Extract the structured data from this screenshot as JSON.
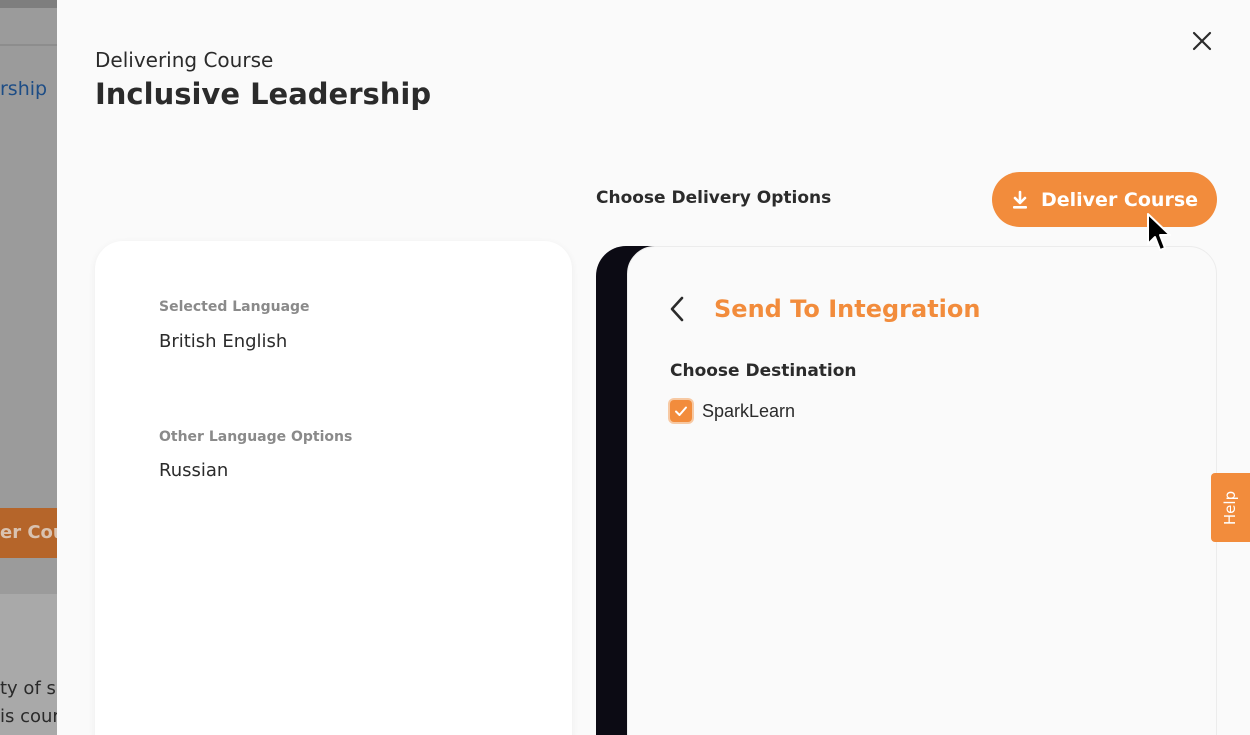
{
  "background": {
    "link_fragment": "rship",
    "button_fragment": "er Cou",
    "text_line1": "ty of sk",
    "text_line2": "is cour"
  },
  "drawer": {
    "subtitle": "Delivering Course",
    "title": "Inclusive Leadership",
    "close_icon": "close-icon"
  },
  "delivery": {
    "label": "Choose Delivery Options",
    "deliver_button": "Deliver Course",
    "deliver_icon": "download-icon"
  },
  "language": {
    "selected_label": "Selected Language",
    "selected_value": "British English",
    "other_label": "Other Language Options",
    "other_value": "Russian"
  },
  "integration": {
    "back_icon": "chevron-left-icon",
    "title": "Send To Integration",
    "destination_label": "Choose Destination",
    "destinations": [
      {
        "label": "SparkLearn",
        "checked": true
      }
    ]
  },
  "help": {
    "label": "Help"
  },
  "colors": {
    "accent": "#f28c3c",
    "text": "#2b2b2b",
    "muted": "#8a8a8a",
    "dark": "#0c0b14"
  }
}
